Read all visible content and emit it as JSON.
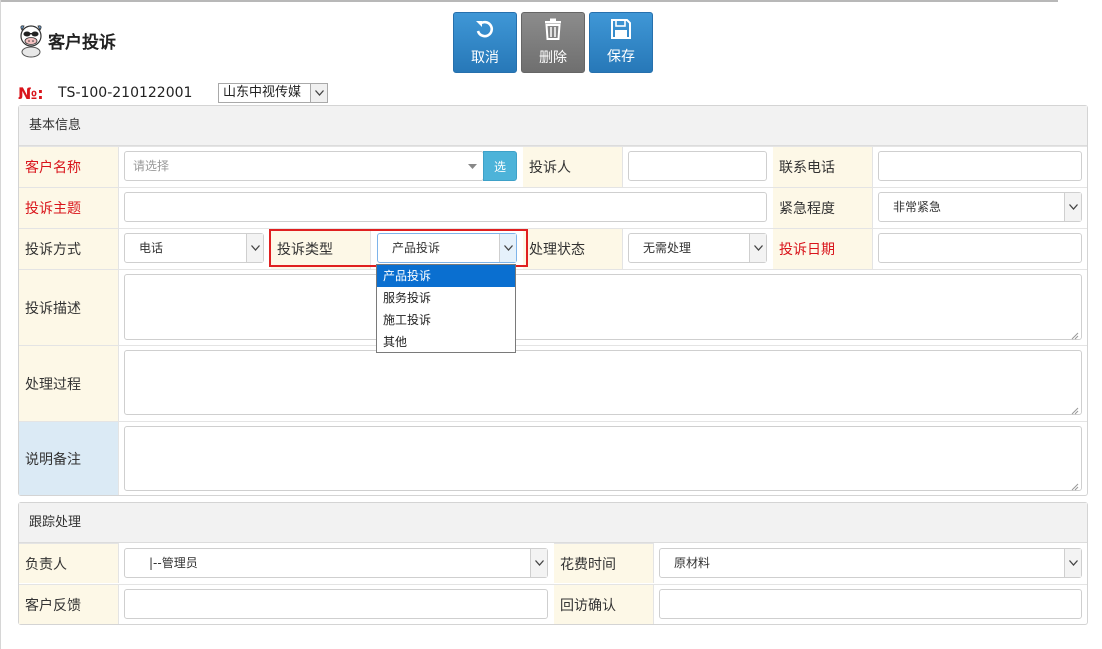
{
  "header": {
    "title": "客户投诉",
    "number_label": "№:",
    "number_value": "TS-100-210122001",
    "company_select": "山东中视传媒"
  },
  "toolbar": {
    "cancel_label": "取消",
    "delete_label": "删除",
    "save_label": "保存"
  },
  "basic_info": {
    "heading": "基本信息",
    "customer_name_label": "客户名称",
    "customer_name_placeholder": "请选择",
    "select_button": "选",
    "complainant_label": "投诉人",
    "phone_label": "联系电话",
    "subject_label": "投诉主题",
    "urgency_label": "紧急程度",
    "urgency_value": "非常紧急",
    "method_label": "投诉方式",
    "method_value": "电话",
    "type_label": "投诉类型",
    "type_value": "产品投诉",
    "status_label": "处理状态",
    "status_value": "无需处理",
    "date_label": "投诉日期",
    "description_label": "投诉描述",
    "process_label": "处理过程",
    "remark_label": "说明备注"
  },
  "type_dropdown": {
    "options": [
      "产品投诉",
      "服务投诉",
      "施工投诉",
      "其他"
    ],
    "selected_index": 0
  },
  "tracking": {
    "heading": "跟踪处理",
    "owner_label": "负责人",
    "owner_value": "|--管理员",
    "time_label": "花费时间",
    "time_value": "原材料",
    "feedback_label": "客户反馈",
    "visit_label": "回访确认"
  },
  "colors": {
    "required_label": "#d9141b",
    "label_bg": "#fdf8e7",
    "primary_button": "#2f86c8",
    "dropdown_highlight": "#e02020",
    "dropdown_selected": "#0a6fd0"
  }
}
